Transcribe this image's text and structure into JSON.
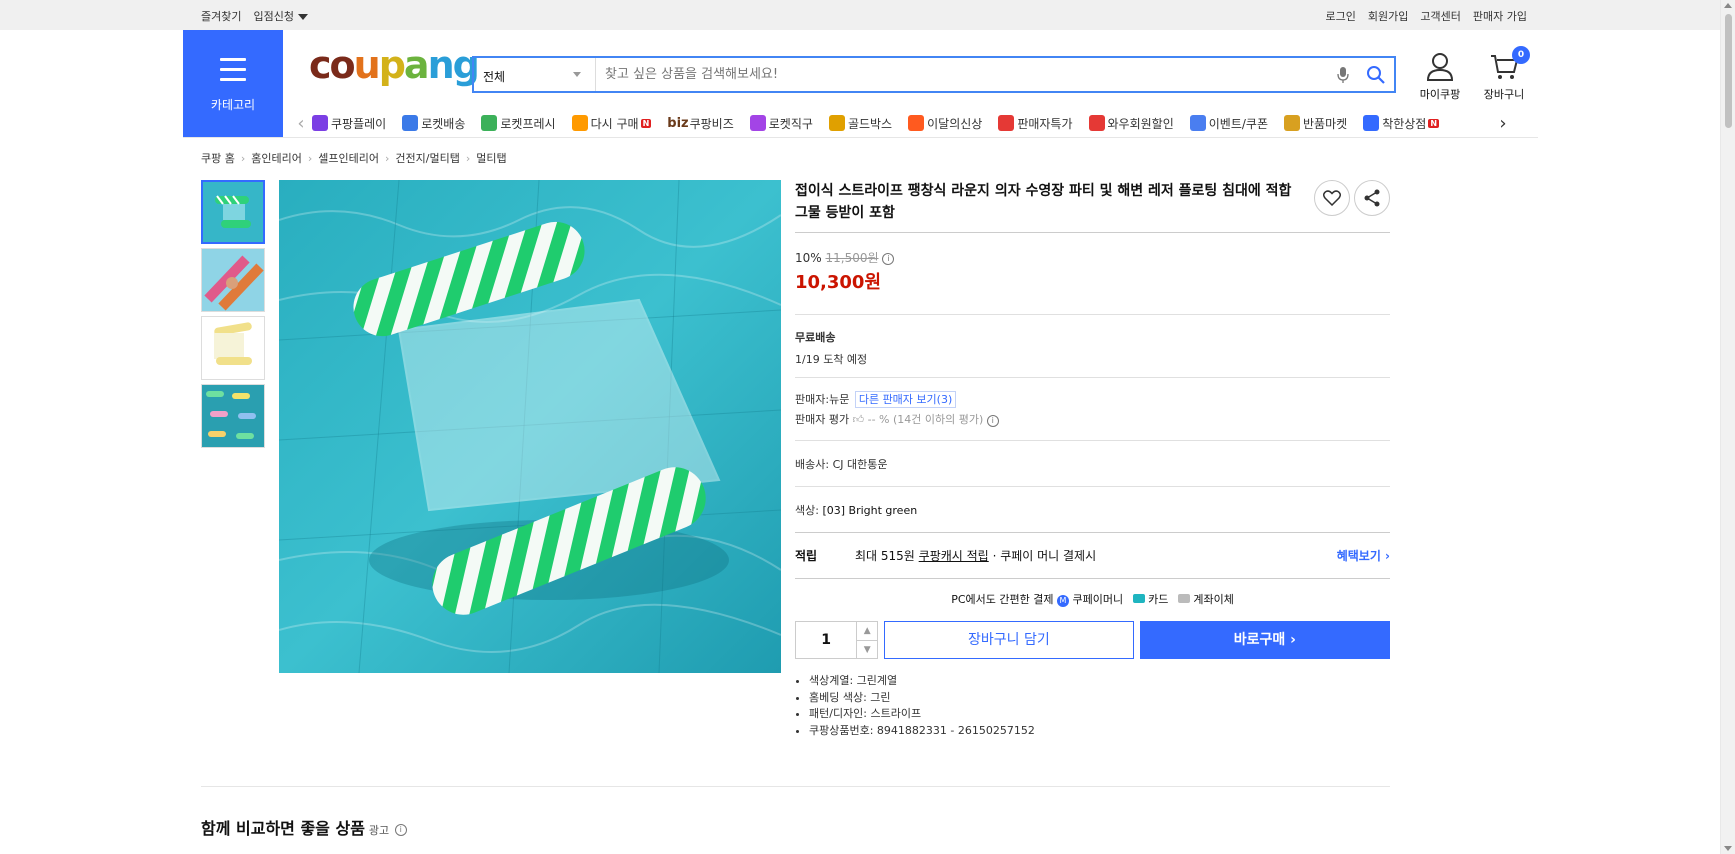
{
  "topbar": {
    "bookmark": "즐겨찾기",
    "apply": "입점신청",
    "login": "로그인",
    "signup": "회원가입",
    "cs": "고객센터",
    "seller_signup": "판매자 가입"
  },
  "header": {
    "category_label": "카테고리",
    "search_category": "전체",
    "search_placeholder": "찾고 싶은 상품을 검색해보세요!",
    "mycoupang": "마이쿠팡",
    "cart_label": "장바구니",
    "cart_count": "0"
  },
  "nav": [
    {
      "label": "쿠팡플레이",
      "icon": "coupang-play-icon",
      "color": "#7b3fe4"
    },
    {
      "label": "로켓배송",
      "icon": "rocket-icon",
      "color": "#3b7ae8"
    },
    {
      "label": "로켓프레시",
      "icon": "rocket-fresh-icon",
      "color": "#3cb15a"
    },
    {
      "label": "다시 구매",
      "icon": "rebuy-icon",
      "color": "#ff9a00",
      "badge": "N"
    },
    {
      "label": "쿠팡비즈",
      "icon": "biz-icon",
      "color": "#6a3a1a",
      "prefix": "biz"
    },
    {
      "label": "로켓직구",
      "icon": "rocket-global-icon",
      "color": "#a344e6"
    },
    {
      "label": "골드박스",
      "icon": "goldbox-icon",
      "color": "#e0a000"
    },
    {
      "label": "이달의신상",
      "icon": "new-items-icon",
      "color": "#ff5a1f"
    },
    {
      "label": "판매자특가",
      "icon": "seller-deal-icon",
      "color": "#e53935"
    },
    {
      "label": "와우회원할인",
      "icon": "wow-icon",
      "color": "#e53935"
    },
    {
      "label": "이벤트/쿠폰",
      "icon": "event-coupon-icon",
      "color": "#4a7ef0"
    },
    {
      "label": "반품마켓",
      "icon": "return-market-icon",
      "color": "#d8a020"
    },
    {
      "label": "착한상점",
      "icon": "good-shop-icon",
      "color": "#346aff",
      "badge": "N"
    }
  ],
  "breadcrumb": [
    "쿠팡 홈",
    "홈인테리어",
    "셀프인테리어",
    "건전지/멀티탭",
    "멀티탭"
  ],
  "product": {
    "title": "접이식 스트라이프 팽창식 라운지 의자 수영장 파티 및 해변 레저 플로팅 침대에 적합 그물 등받이 포함",
    "discount_rate": "10%",
    "original_price": "11,500원",
    "price": "10,300원",
    "shipping_title": "무료배송",
    "arrival": "1/19 도착 예정",
    "seller_label": "판매자:",
    "seller_name": "뉴문",
    "other_sellers": "다른 판매자 보기(3)",
    "seller_rating_label": "판매자 평가",
    "seller_rating_value": "-- %",
    "seller_rating_note": "(14건 이하의 평가)",
    "courier_label": "배송사:",
    "courier": "CJ 대한통운",
    "color_label": "색상:",
    "color_value": "[03] Bright green",
    "reward_label": "적립",
    "reward_text_1": "최대 515원",
    "reward_link": "쿠팡캐시 적립",
    "reward_text_2": "· 쿠페이 머니 결제시",
    "benefit_link": "혜택보기",
    "pc_pay_text": "PC에서도 간편한 결제",
    "pay_money": "쿠페이머니",
    "pay_card": "카드",
    "pay_bank": "계좌이체",
    "quantity": "1",
    "add_cart": "장바구니 담기",
    "buy_now": "바로구매",
    "attributes": [
      "색상계열: 그린계열",
      "홈베딩 색상: 그린",
      "패턴/디자인: 스트라이프",
      "쿠팡상품번호: 8941882331 - 26150257152"
    ]
  },
  "compare": {
    "title": "함께 비교하면 좋을 상품",
    "ad": "광고"
  },
  "colors": {
    "brand_blue": "#346aff",
    "price_red": "#cb1400"
  }
}
